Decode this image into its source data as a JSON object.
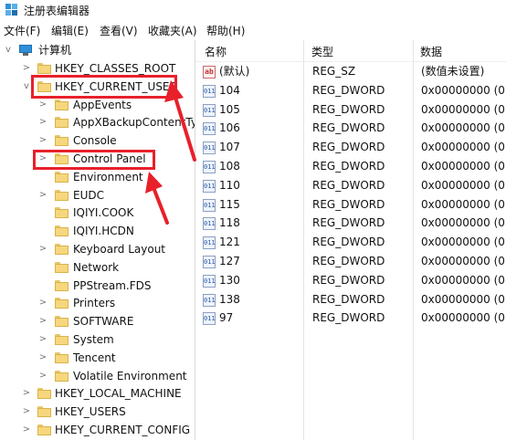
{
  "window": {
    "title": "注册表编辑器",
    "icon": "registry-editor-icon"
  },
  "menu": [
    "文件(F)",
    "编辑(E)",
    "查看(V)",
    "收藏夹(A)",
    "帮助(H)"
  ],
  "tree": {
    "root": "计算机",
    "nodes": [
      {
        "label": "HKEY_CLASSES_ROOT",
        "level": 1,
        "expander": ">"
      },
      {
        "label": "HKEY_CURRENT_USER",
        "level": 1,
        "expander": "v",
        "highlighted": true
      },
      {
        "label": "AppEvents",
        "level": 2,
        "expander": ">"
      },
      {
        "label": "AppXBackupContentTy",
        "level": 2,
        "expander": ">"
      },
      {
        "label": "Console",
        "level": 2,
        "expander": ">"
      },
      {
        "label": "Control Panel",
        "level": 2,
        "expander": ">",
        "highlighted": true
      },
      {
        "label": "Environment",
        "level": 2,
        "expander": ""
      },
      {
        "label": "EUDC",
        "level": 2,
        "expander": ">"
      },
      {
        "label": "IQIYI.COOK",
        "level": 2,
        "expander": ""
      },
      {
        "label": "IQIYI.HCDN",
        "level": 2,
        "expander": ""
      },
      {
        "label": "Keyboard Layout",
        "level": 2,
        "expander": ">"
      },
      {
        "label": "Network",
        "level": 2,
        "expander": ""
      },
      {
        "label": "PPStream.FDS",
        "level": 2,
        "expander": ""
      },
      {
        "label": "Printers",
        "level": 2,
        "expander": ">"
      },
      {
        "label": "SOFTWARE",
        "level": 2,
        "expander": ">"
      },
      {
        "label": "System",
        "level": 2,
        "expander": ">"
      },
      {
        "label": "Tencent",
        "level": 2,
        "expander": ">"
      },
      {
        "label": "Volatile Environment",
        "level": 2,
        "expander": ">"
      },
      {
        "label": "HKEY_LOCAL_MACHINE",
        "level": 1,
        "expander": ">"
      },
      {
        "label": "HKEY_USERS",
        "level": 1,
        "expander": ">"
      },
      {
        "label": "HKEY_CURRENT_CONFIG",
        "level": 1,
        "expander": ">"
      }
    ]
  },
  "values": {
    "columns": [
      "名称",
      "类型",
      "数据"
    ],
    "rows": [
      {
        "name": "(默认)",
        "type": "REG_SZ",
        "data": "(数值未设置)",
        "icon": "ab"
      },
      {
        "name": "104",
        "type": "REG_DWORD",
        "data": "0x00000000 (0)",
        "icon": "011"
      },
      {
        "name": "105",
        "type": "REG_DWORD",
        "data": "0x00000000 (0)",
        "icon": "011"
      },
      {
        "name": "106",
        "type": "REG_DWORD",
        "data": "0x00000000 (0)",
        "icon": "011"
      },
      {
        "name": "107",
        "type": "REG_DWORD",
        "data": "0x00000000 (0)",
        "icon": "011"
      },
      {
        "name": "108",
        "type": "REG_DWORD",
        "data": "0x00000000 (0)",
        "icon": "011"
      },
      {
        "name": "110",
        "type": "REG_DWORD",
        "data": "0x00000000 (0)",
        "icon": "011"
      },
      {
        "name": "115",
        "type": "REG_DWORD",
        "data": "0x00000000 (0)",
        "icon": "011"
      },
      {
        "name": "118",
        "type": "REG_DWORD",
        "data": "0x00000000 (0)",
        "icon": "011"
      },
      {
        "name": "121",
        "type": "REG_DWORD",
        "data": "0x00000000 (0)",
        "icon": "011"
      },
      {
        "name": "127",
        "type": "REG_DWORD",
        "data": "0x00000000 (0)",
        "icon": "011"
      },
      {
        "name": "130",
        "type": "REG_DWORD",
        "data": "0x00000000 (0)",
        "icon": "011"
      },
      {
        "name": "138",
        "type": "REG_DWORD",
        "data": "0x00000000 (0)",
        "icon": "011"
      },
      {
        "name": "97",
        "type": "REG_DWORD",
        "data": "0x00000000 (0)",
        "icon": "011"
      }
    ]
  },
  "annotation": {
    "color": "#e8202a"
  }
}
